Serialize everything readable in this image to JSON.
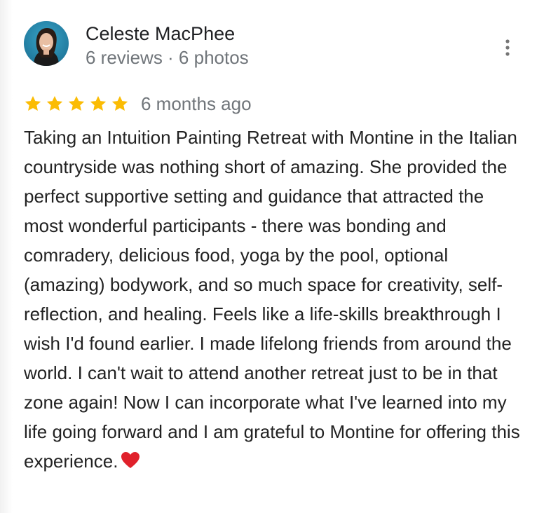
{
  "reviewer": {
    "name": "Celeste MacPhee",
    "meta": "6 reviews · 6 photos",
    "avatar_icon": "avatar-photo"
  },
  "menu": {
    "icon": "more-vert-icon"
  },
  "rating": {
    "stars": 5,
    "max_stars": 5,
    "star_color": "#fbbc04",
    "time": "6 months ago"
  },
  "review": {
    "text": "Taking an Intuition Painting Retreat with Montine in the Italian countryside was nothing short of amazing. She provided the perfect supportive setting and guidance that attracted the most wonderful participants - there was bonding and comradery, delicious food, yoga by the pool, optional (amazing) bodywork, and so much space for creativity, self-reflection, and healing. Feels like a life-skills breakthrough I wish I'd found earlier. I made lifelong friends from around the world. I can't wait to attend another retreat just to be in that zone again! Now I can incorporate what I've learned into my life going forward and I am grateful to Montine for offering this experience.",
    "emoji": "heart-icon",
    "emoji_color": "#e0212b"
  }
}
